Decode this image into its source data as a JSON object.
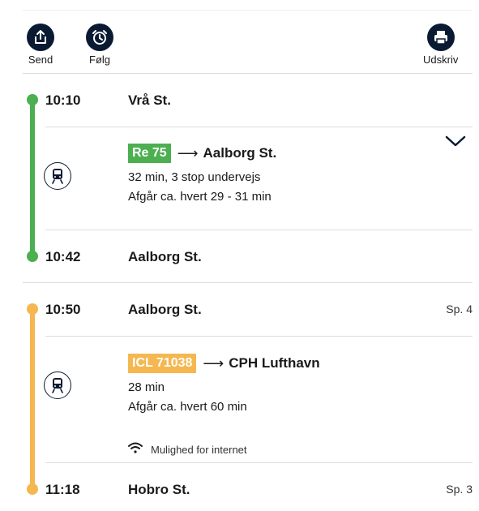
{
  "toolbar": {
    "send_label": "Send",
    "follow_label": "Følg",
    "print_label": "Udskriv"
  },
  "colors": {
    "green_line": "#4caf50",
    "orange_line": "#f5b74f",
    "navy": "#0b1a33"
  },
  "journey": {
    "stop1": {
      "time": "10:10",
      "station": "Vrå St."
    },
    "leg1": {
      "badge": "Re 75",
      "arrow": "⟶",
      "destination": "Aalborg St.",
      "duration": "32 min, 3 stop undervejs",
      "frequency": "Afgår ca. hvert 29 - 31 min",
      "icon": "train-icon"
    },
    "stop2": {
      "time": "10:42",
      "station": "Aalborg St."
    },
    "stop3": {
      "time": "10:50",
      "station": "Aalborg St.",
      "platform": "Sp. 4"
    },
    "leg2": {
      "badge": "ICL 71038",
      "arrow": "⟶",
      "destination": "CPH Lufthavn",
      "duration": "28 min",
      "frequency": "Afgår ca. hvert 60 min",
      "wifi_note": "Mulighed for internet",
      "icon": "train-icon"
    },
    "stop4": {
      "time": "11:18",
      "station": "Hobro St.",
      "platform": "Sp. 3"
    }
  }
}
